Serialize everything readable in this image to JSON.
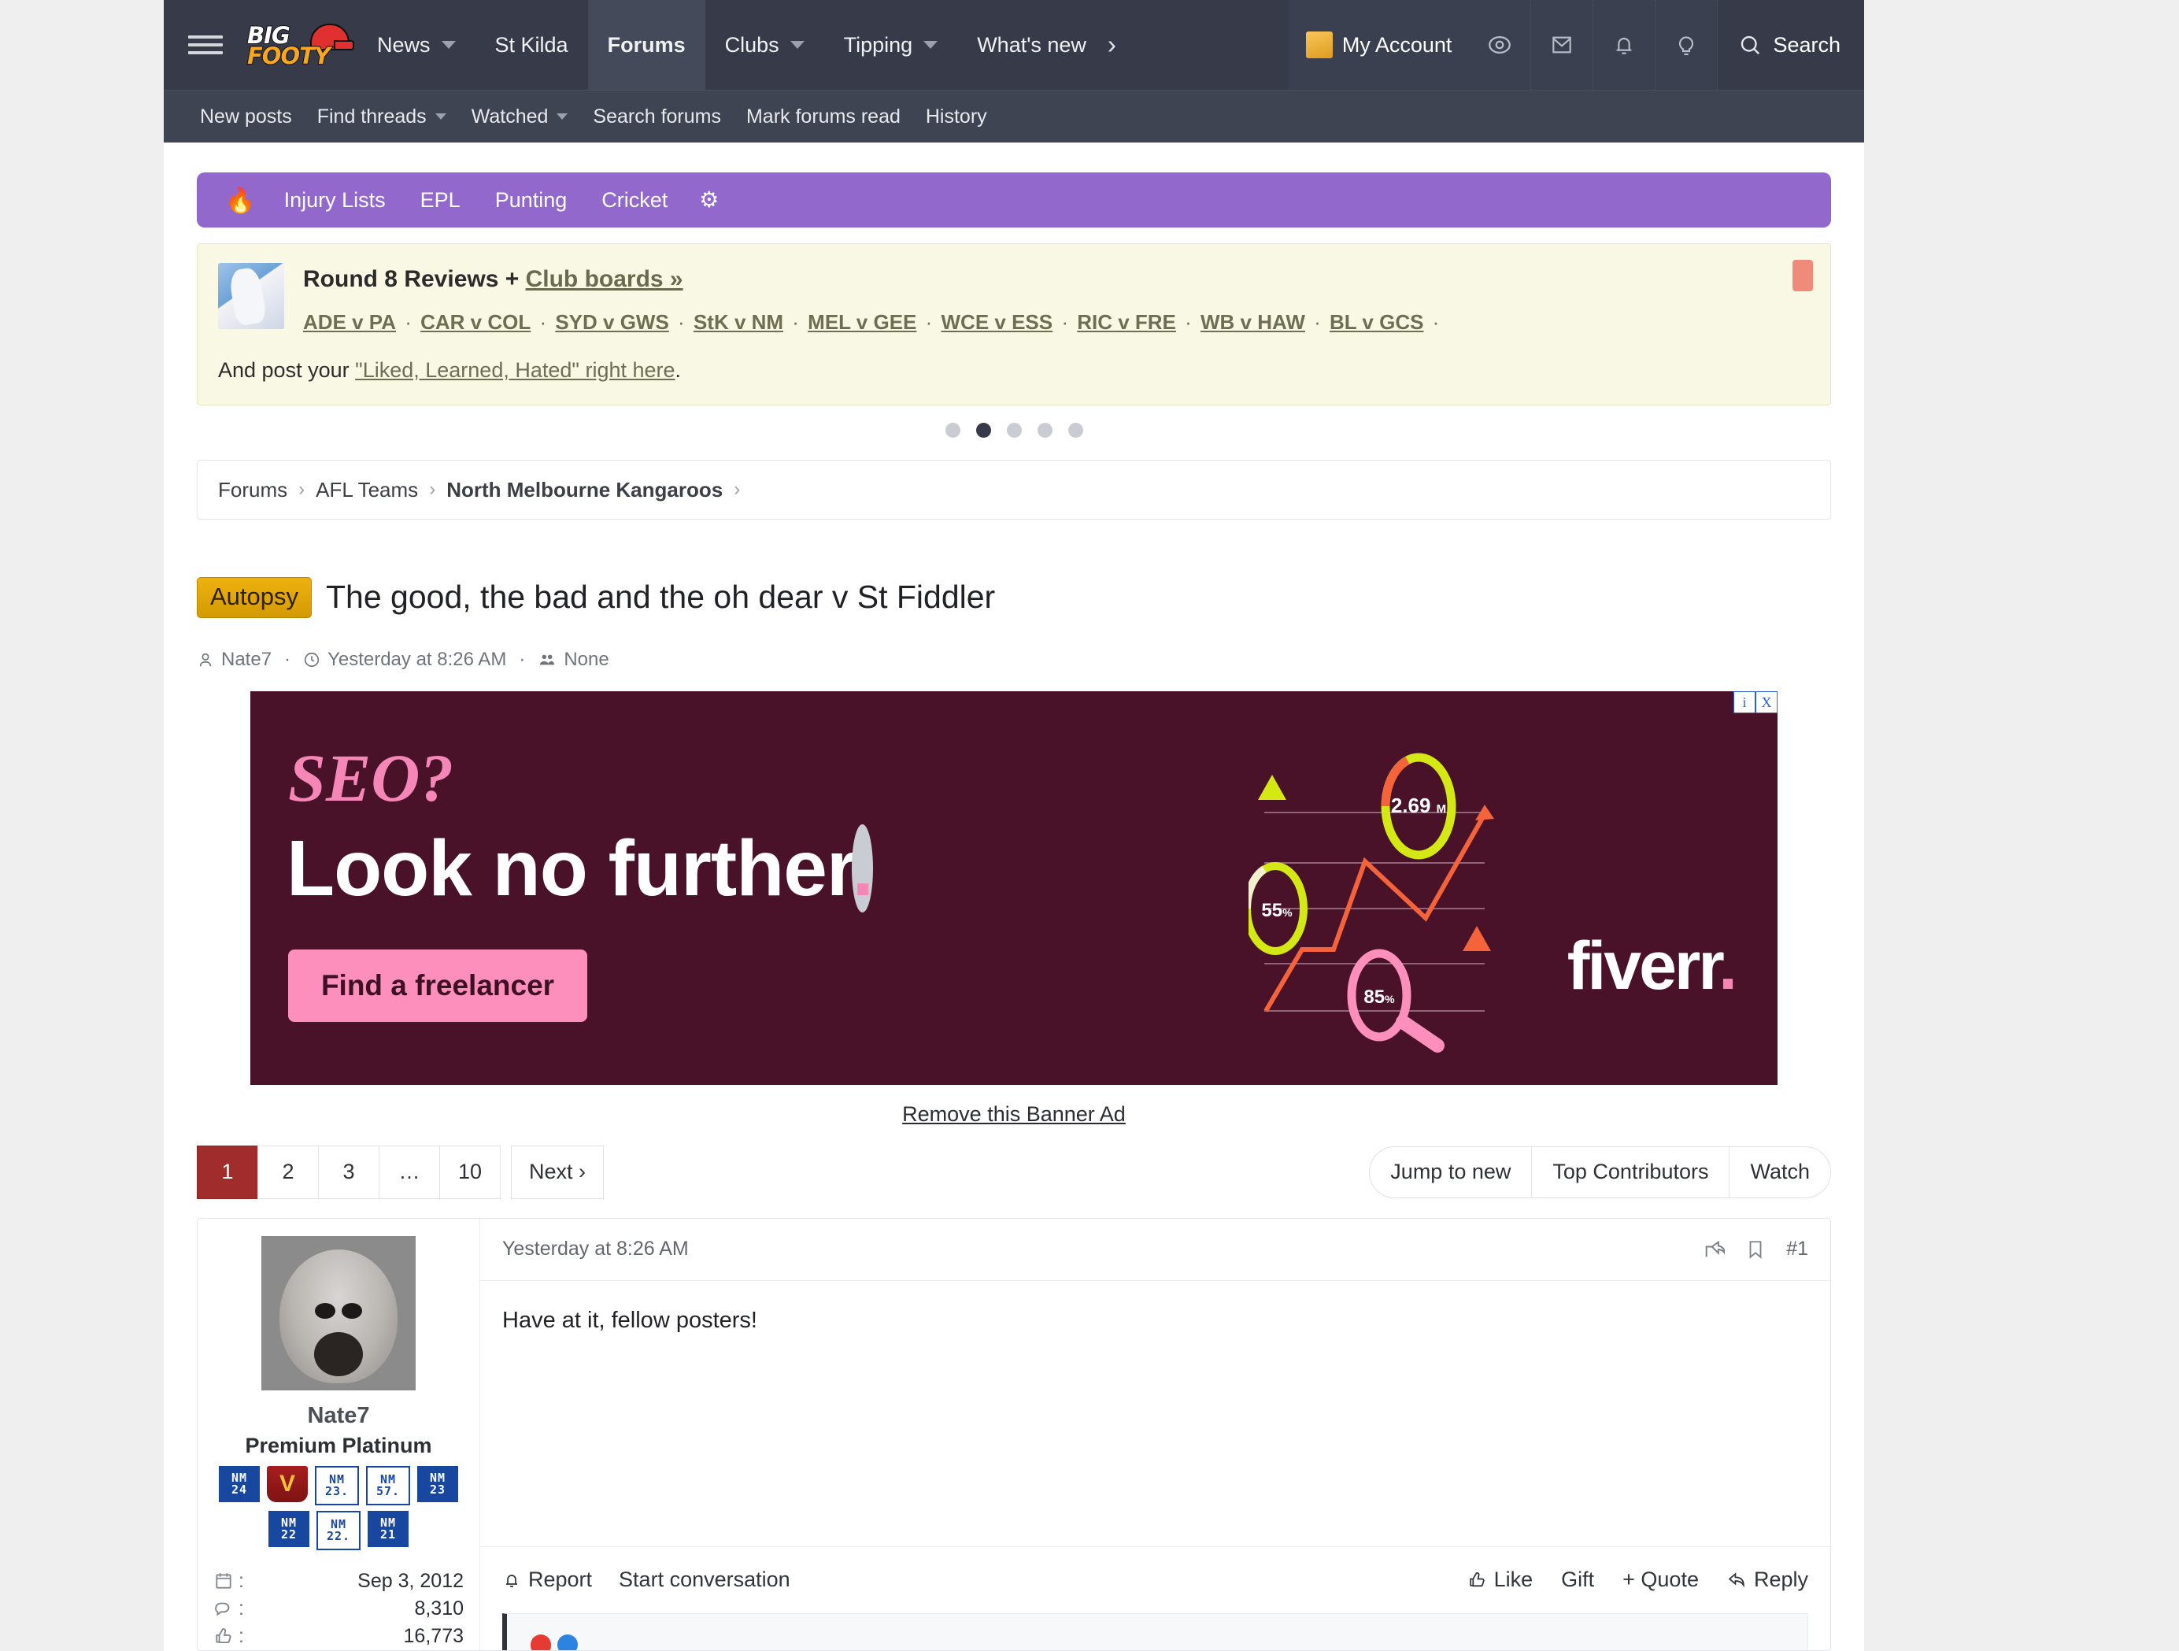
{
  "nav": {
    "logo_top": "BIG",
    "logo_bottom": "FOOTY",
    "items": [
      {
        "label": "News",
        "caret": true,
        "active": false
      },
      {
        "label": "St Kilda",
        "caret": false,
        "active": false
      },
      {
        "label": "Forums",
        "caret": false,
        "active": true
      },
      {
        "label": "Clubs",
        "caret": true,
        "active": false
      },
      {
        "label": "Tipping",
        "caret": true,
        "active": false
      },
      {
        "label": "What's new",
        "caret": false,
        "active": false
      }
    ],
    "overflow_arrow": "›",
    "account_label": "My Account",
    "icons": [
      "eye-icon",
      "envelope-icon",
      "bell-icon",
      "lightbulb-icon"
    ],
    "search_label": "Search"
  },
  "subnav": {
    "items": [
      {
        "label": "New posts",
        "caret": false
      },
      {
        "label": "Find threads",
        "caret": true
      },
      {
        "label": "Watched",
        "caret": true
      },
      {
        "label": "Search forums",
        "caret": false
      },
      {
        "label": "Mark forums read",
        "caret": false
      },
      {
        "label": "History",
        "caret": false
      }
    ]
  },
  "purple_bar": {
    "flame_icon": "🔥",
    "items": [
      "Injury Lists",
      "EPL",
      "Punting",
      "Cricket"
    ],
    "gear_icon": "⚙",
    "color": "#9368cd"
  },
  "notice": {
    "title_plain": "Round 8 Reviews + ",
    "title_link": "Club boards »",
    "match_links": [
      "ADE v PA",
      "CAR v COL",
      "SYD v GWS",
      "StK v NM",
      "MEL v GEE",
      "WCE v ESS",
      "RIC v FRE",
      "WB v HAW",
      "BL v GCS"
    ],
    "footer_before": "And post your ",
    "footer_link": "\"Liked, Learned, Hated\" right here",
    "footer_after": ".",
    "background": "#f9f8e4"
  },
  "carousel": {
    "count": 5,
    "active_index": 1
  },
  "breadcrumb": {
    "items": [
      "Forums",
      "AFL Teams",
      "North Melbourne Kangaroos"
    ],
    "separator": "›"
  },
  "thread": {
    "prefix": "Autopsy",
    "title": "The good, the bad and the oh dear v St Fiddler",
    "author": "Nate7",
    "date": "Yesterday at 8:26 AM",
    "watchers": "None"
  },
  "ad": {
    "eyebrow": "SEO?",
    "headline": "Look no further",
    "headline_dot": ".",
    "cta": "Find a freelancer",
    "brand": "fiverr",
    "brand_dot": ".",
    "info_badge": "i",
    "close_badge": "X",
    "metrics": [
      "2.69 M",
      "55%",
      "85%"
    ],
    "background": "#4a1229",
    "accent_pink": "#f587b8",
    "accent_lime": "#d4e814",
    "accent_orange": "#f4633a"
  },
  "remove_ad_label": "Remove this Banner Ad",
  "pagination": {
    "pages": [
      "1",
      "2",
      "3",
      "…",
      "10"
    ],
    "current": "1",
    "next_label": "Next ›"
  },
  "thread_buttons": [
    "Jump to new",
    "Top Contributors",
    "Watch"
  ],
  "post": {
    "timestamp": "Yesterday at 8:26 AM",
    "share_icon": "share-icon",
    "bookmark_icon": "bookmark-icon",
    "number": "#1",
    "message": "Have at it, fellow posters!",
    "footer_left": [
      "Report",
      "Start conversation"
    ],
    "footer_right": [
      "Like",
      "Gift",
      "+ Quote",
      "Reply"
    ]
  },
  "user": {
    "name": "Nate7",
    "title": "Premium Platinum",
    "badges": [
      {
        "type": "nm",
        "top": "NM",
        "bottom": "24",
        "style": "dark"
      },
      {
        "type": "v",
        "label": "V"
      },
      {
        "type": "nm",
        "top": "NM",
        "bottom": "23.",
        "style": "light"
      },
      {
        "type": "nm",
        "top": "NM",
        "bottom": "57.",
        "style": "light"
      },
      {
        "type": "nm",
        "top": "NM",
        "bottom": "23",
        "style": "dark"
      },
      {
        "type": "nm",
        "top": "NM",
        "bottom": "22",
        "style": "dark"
      },
      {
        "type": "nm",
        "top": "NM",
        "bottom": "22.",
        "style": "light"
      },
      {
        "type": "nm",
        "top": "NM",
        "bottom": "21",
        "style": "dark"
      }
    ],
    "stats": [
      {
        "icon": "calendar-icon",
        "value": "Sep 3, 2012"
      },
      {
        "icon": "comment-icon",
        "value": "8,310"
      },
      {
        "icon": "thumbs-up-icon",
        "value": "16,773"
      }
    ]
  }
}
